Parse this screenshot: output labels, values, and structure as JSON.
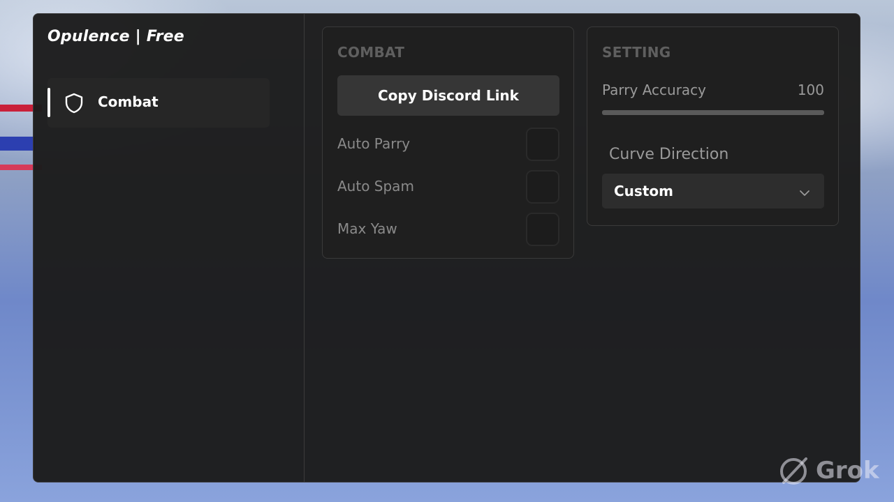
{
  "app": {
    "title": "Opulence | Free"
  },
  "sidebar": {
    "items": [
      {
        "label": "Combat",
        "icon": "shield-icon",
        "active": true
      }
    ]
  },
  "combat_panel": {
    "title": "COMBAT",
    "copy_button_label": "Copy Discord Link",
    "toggles": [
      {
        "label": "Auto Parry",
        "checked": false
      },
      {
        "label": "Auto Spam",
        "checked": false
      },
      {
        "label": "Max Yaw",
        "checked": false
      }
    ]
  },
  "setting_panel": {
    "title": "SETTING",
    "parry_accuracy": {
      "label": "Parry Accuracy",
      "value": "100",
      "fill_fraction": 1.0
    },
    "curve_direction": {
      "label": "Curve Direction",
      "selected": "Custom",
      "icon": "chevron-down-icon"
    }
  },
  "watermark": {
    "text": "Grok",
    "icon": "grok-logo-icon"
  },
  "colors": {
    "window_bg": "#1c1c1c",
    "panel_bg": "#1f1f1f",
    "muted_text": "#8a8a8a",
    "accent_white": "#ffffff"
  }
}
